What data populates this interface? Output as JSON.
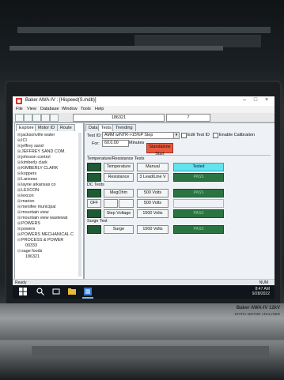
{
  "app": {
    "title": "Baker AWA-IV : [Hispeed(S.mdb)]",
    "window_controls": [
      "–",
      "□",
      "×"
    ]
  },
  "menu": [
    "File",
    "View",
    "Database",
    "Window",
    "Tools",
    "Help"
  ],
  "toolbar": {
    "field1": "186321",
    "field2": "7"
  },
  "left_tabs": [
    "Explore",
    "Motor ID",
    "Route"
  ],
  "tree_items": [
    "jacksonville water",
    "ICI",
    "jeffrey sand",
    "JEFFREY SAND COM.",
    "johnson control",
    "kimberly clark",
    "KIMBERLY CLARK",
    "koppers",
    "Lanxess",
    "layne arkansas co",
    "LEXCON",
    "lexcon",
    "marion",
    "menifee municipal",
    "mountain view",
    "mountain view wastewat",
    "POWERS",
    "powers",
    "POWERS MECHANICAL C",
    "PROCESS & POWER",
    "00333",
    "sage foods",
    "186321"
  ],
  "right_tabs": [
    "Data",
    "Tests",
    "Trending"
  ],
  "tests": {
    "test_id_label": "Test ID:",
    "test_id_value": "AMM w/NTR->15%P Step",
    "for_label": "For:",
    "for_value": "60.0.00",
    "minutes_label": "Minutes",
    "edit_test_id": "Edit Test ID",
    "enable_calibration": "Enable Calibration",
    "start_label": "Standalone Start",
    "section_temp": "Temperature/Resistance Tests",
    "section_dc": "DC Tests",
    "section_surge": "Surge Test",
    "btn_temperature": "Temperature",
    "btn_manual": "Manual",
    "status_tested": "Tested",
    "btn_resistance": "Resistance",
    "btn_3lead": "3 Lead/Line V",
    "status_pass": "PASS",
    "btn_megohm": "MegOhm",
    "val_500": "500 Volts",
    "off_label": "OFF",
    "btn_step_voltage": "Step Voltage",
    "val_1500": "1500 Volts",
    "btn_surge": "Surge"
  },
  "status_bar": {
    "left": "Ready",
    "right": "NUM"
  },
  "taskbar": {
    "time": "8:47 AM",
    "date": "9/28/2022"
  },
  "hardware": {
    "brand": "Baker AWA-IV 12kV",
    "model": "STATIC MOTOR ANALYZER"
  },
  "colors": {
    "green": "#2a7442",
    "cyan": "#62e4ee",
    "red": "#e95a3e"
  }
}
